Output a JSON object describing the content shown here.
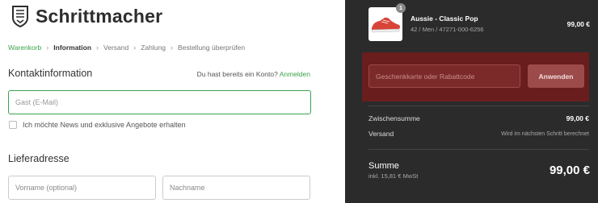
{
  "brand": {
    "name": "Schrittmacher"
  },
  "breadcrumb": {
    "items": [
      "Warenkorb",
      "Information",
      "Versand",
      "Zahlung",
      "Bestellung überprüfen"
    ]
  },
  "contact": {
    "heading": "Kontaktinformation",
    "account_prompt": "Du hast bereits ein Konto?",
    "login_link": "Anmelden",
    "email_placeholder": "Gast (E-Mail)",
    "newsletter_label": "Ich möchte News und exklusive Angebote erhalten"
  },
  "address": {
    "heading": "Lieferadresse",
    "first_name_placeholder": "Vorname (optional)",
    "last_name_placeholder": "Nachname"
  },
  "cart": {
    "item": {
      "quantity": "1",
      "name": "Aussie - Classic Pop",
      "meta": "42 / Men / 47271-000-6256",
      "price": "99,00 €"
    },
    "coupon_placeholder": "Geschenkkarte oder Rabattcode",
    "apply_label": "Anwenden",
    "subtotal_label": "Zwischensumme",
    "subtotal_value": "99,00 €",
    "shipping_label": "Versand",
    "shipping_value": "Wird im nächsten Schritt berechnet",
    "total_label": "Summe",
    "tax_note": "inkl. 15,81 € MwSt",
    "total_value": "99,00 €"
  },
  "colors": {
    "accent": "#3aa34a",
    "sidebar_bg": "#2b2b2b",
    "coupon_bg": "#6a1d1d"
  }
}
